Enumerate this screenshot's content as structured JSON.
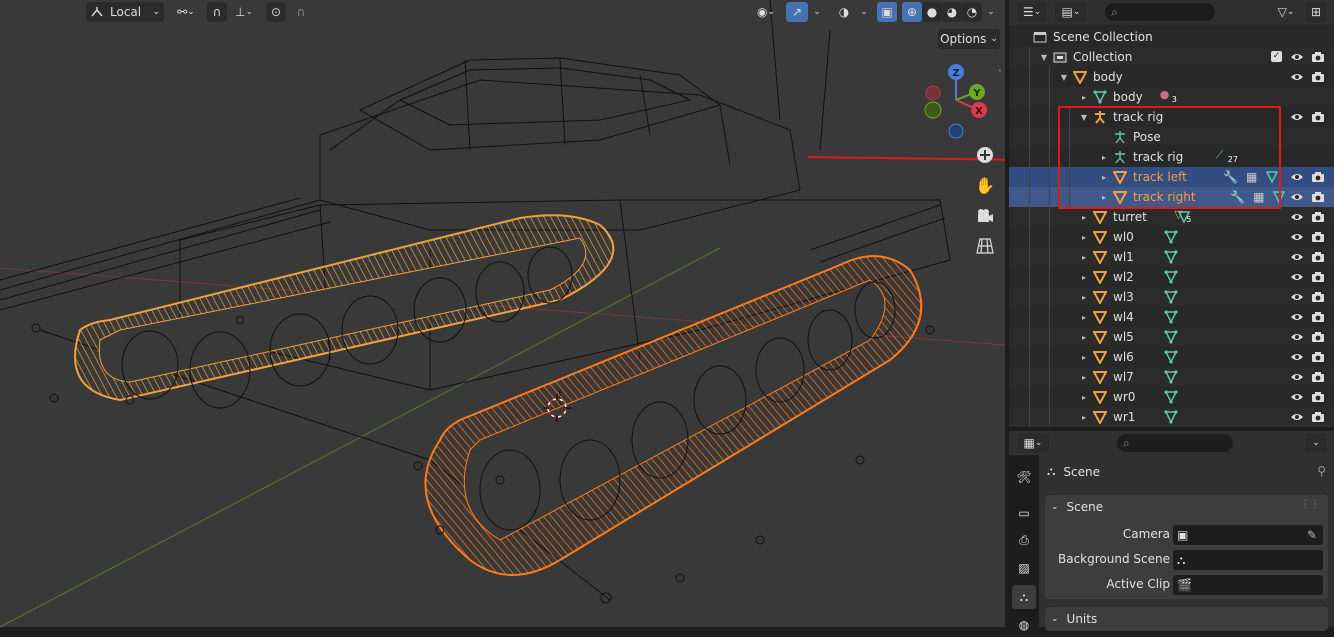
{
  "viewport": {
    "transform_orientation": "Local",
    "options_label": "Options",
    "gizmo_axes": {
      "z": "Z",
      "y": "Y",
      "x": "X"
    }
  },
  "outliner": {
    "search_placeholder": "",
    "rows": [
      {
        "label": "Scene Collection",
        "icon": "scene-collection-icon",
        "depth": 0,
        "expander": ""
      },
      {
        "label": "Collection",
        "icon": "collection-icon",
        "depth": 1,
        "expander": "▼"
      },
      {
        "label": "body",
        "icon": "object-mesh-icon",
        "depth": 2,
        "expander": "▼"
      },
      {
        "label": "body",
        "icon": "mesh-data-icon",
        "depth": 3,
        "expander": "▸",
        "badge": "3"
      },
      {
        "label": "track rig",
        "icon": "armature-icon",
        "depth": 3,
        "expander": "▼"
      },
      {
        "label": "Pose",
        "icon": "pose-icon",
        "depth": 4,
        "expander": ""
      },
      {
        "label": "track rig",
        "icon": "armature-data-icon",
        "depth": 4,
        "expander": "▸",
        "badge": "27"
      },
      {
        "label": "track left",
        "icon": "object-mesh-icon",
        "depth": 4,
        "expander": "▸",
        "selected": true
      },
      {
        "label": "track right",
        "icon": "object-mesh-icon",
        "depth": 4,
        "expander": "▸",
        "selected": true,
        "active": true
      },
      {
        "label": "turret",
        "icon": "object-mesh-icon",
        "depth": 3,
        "expander": "▸",
        "badge": "5"
      },
      {
        "label": "wl0",
        "icon": "object-mesh-icon",
        "depth": 3,
        "expander": "▸"
      },
      {
        "label": "wl1",
        "icon": "object-mesh-icon",
        "depth": 3,
        "expander": "▸"
      },
      {
        "label": "wl2",
        "icon": "object-mesh-icon",
        "depth": 3,
        "expander": "▸"
      },
      {
        "label": "wl3",
        "icon": "object-mesh-icon",
        "depth": 3,
        "expander": "▸"
      },
      {
        "label": "wl4",
        "icon": "object-mesh-icon",
        "depth": 3,
        "expander": "▸"
      },
      {
        "label": "wl5",
        "icon": "object-mesh-icon",
        "depth": 3,
        "expander": "▸"
      },
      {
        "label": "wl6",
        "icon": "object-mesh-icon",
        "depth": 3,
        "expander": "▸"
      },
      {
        "label": "wl7",
        "icon": "object-mesh-icon",
        "depth": 3,
        "expander": "▸"
      },
      {
        "label": "wr0",
        "icon": "object-mesh-icon",
        "depth": 3,
        "expander": "▸"
      },
      {
        "label": "wr1",
        "icon": "object-mesh-icon",
        "depth": 3,
        "expander": "▸"
      }
    ]
  },
  "properties": {
    "context_title": "Scene",
    "panel_scene_title": "Scene",
    "camera_label": "Camera",
    "camera_value": "",
    "background_scene_label": "Background Scene",
    "background_scene_value": "",
    "active_clip_label": "Active Clip",
    "active_clip_value": "",
    "panel_units_title": "Units"
  },
  "colors": {
    "selected_object": "#f0a03c",
    "active_object": "#ff7a1a",
    "highlight_box": "#e01818",
    "selection_row": "#334d80"
  }
}
